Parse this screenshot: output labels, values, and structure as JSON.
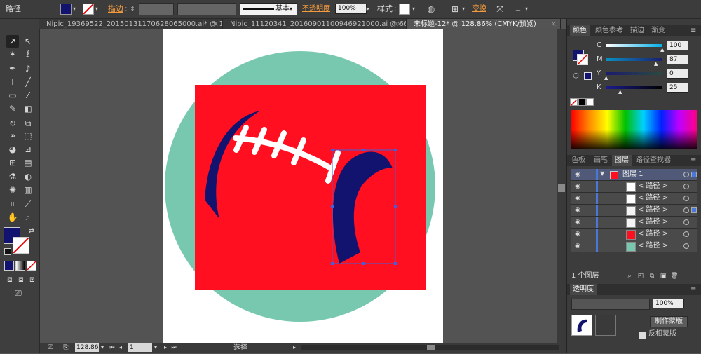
{
  "control_bar": {
    "selection_label": "路径",
    "stroke_label": "描边",
    "stroke_style_label": "基本",
    "opacity_label": "不透明度",
    "opacity_value": "100%",
    "style_label": "样式",
    "transform_label": "变换"
  },
  "doc_tabs": [
    {
      "label": "Nipic_19369522_20150131170628065000.ai* @ 10..."
    },
    {
      "label": "Nipic_11120341_20160901100946921000.ai @ 66..."
    },
    {
      "label": "未标题-12* @ 128.86% (CMYK/预览)"
    }
  ],
  "status_bar": {
    "zoom": "128.86",
    "page": "1",
    "tool_label": "选择"
  },
  "color_panel": {
    "tabs": [
      "颜色",
      "颜色参考",
      "描边",
      "渐变"
    ],
    "channels": [
      {
        "name": "C",
        "value": "100"
      },
      {
        "name": "M",
        "value": "87"
      },
      {
        "name": "Y",
        "value": "0"
      },
      {
        "name": "K",
        "value": "25"
      }
    ]
  },
  "layers_panel": {
    "tabs": [
      "色板",
      "画笔",
      "图层",
      "路径查找器"
    ],
    "layer_name": "图层 1",
    "items": [
      {
        "label": "< 路径 >",
        "thumb": "#ffffff"
      },
      {
        "label": "< 路径 >",
        "thumb": "#ffffff"
      },
      {
        "label": "< 路径 >",
        "thumb": "#f4f4f4"
      },
      {
        "label": "< 路径 >",
        "thumb": "#f4f4f4"
      },
      {
        "label": "< 路径 >",
        "thumb": "#ff0f1f"
      },
      {
        "label": "< 路径 >",
        "thumb": "#78c8b0"
      }
    ],
    "footer_count": "1 个图层"
  },
  "transparency_panel": {
    "title": "透明度",
    "opacity_value": "100%",
    "make_mask_button": "制作蒙版",
    "invert_mask_label": "反相蒙版"
  },
  "colors": {
    "fill": "#12136e",
    "artboard": "#ffffff",
    "circle": "#78c8b0",
    "square": "#ff0f1f",
    "stitches": "#ffffff",
    "accent": "#4060e0"
  }
}
